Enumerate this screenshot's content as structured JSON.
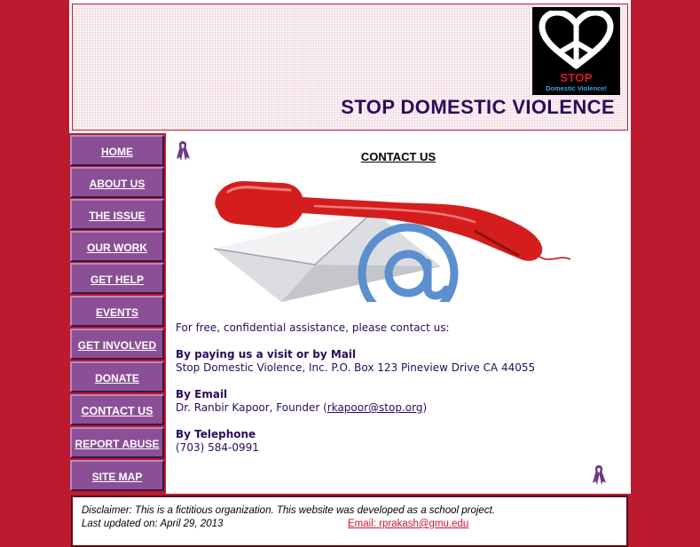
{
  "header": {
    "title": "STOP DOMESTIC VIOLENCE",
    "logo": {
      "heading": "STOP",
      "subheading": "Domestic Violence!"
    }
  },
  "nav": {
    "items": [
      {
        "label": "HOME"
      },
      {
        "label": "ABOUT US"
      },
      {
        "label": "THE ISSUE"
      },
      {
        "label": "OUR WORK"
      },
      {
        "label": "GET HELP"
      },
      {
        "label": "EVENTS"
      },
      {
        "label": "GET INVOLVED"
      },
      {
        "label": "DONATE"
      },
      {
        "label": "CONTACT US",
        "active": true
      },
      {
        "label": "REPORT ABUSE"
      },
      {
        "label": "SITE MAP"
      }
    ]
  },
  "main": {
    "title": "CONTACT US",
    "intro": "For free, confidential assistance, please contact us:",
    "visit_heading": "By paying us a visit or by Mail",
    "visit_text": "Stop Domestic Violence, Inc. P.O. Box 123 Pineview Drive CA 44055",
    "email_heading": "By Email",
    "email_prefix": "Dr. Ranbir Kapoor, Founder (",
    "email_link": "rkapoor@stop.org",
    "email_suffix": ")",
    "phone_heading": "By Telephone",
    "phone_text": "(703) 584-0991"
  },
  "footer": {
    "disclaimer": "Disclaimer: This is a fictitious organization. This website was developed as a school project.",
    "updated": "Last updated on: April 29, 2013",
    "email_label": "Email: rprakash@gmu.edu"
  },
  "colors": {
    "background": "#bc1a2e",
    "nav": "#8a4f96",
    "title_text": "#2e0a5c",
    "phone_red": "#d41e1e",
    "at_blue": "#5b8fcf"
  }
}
